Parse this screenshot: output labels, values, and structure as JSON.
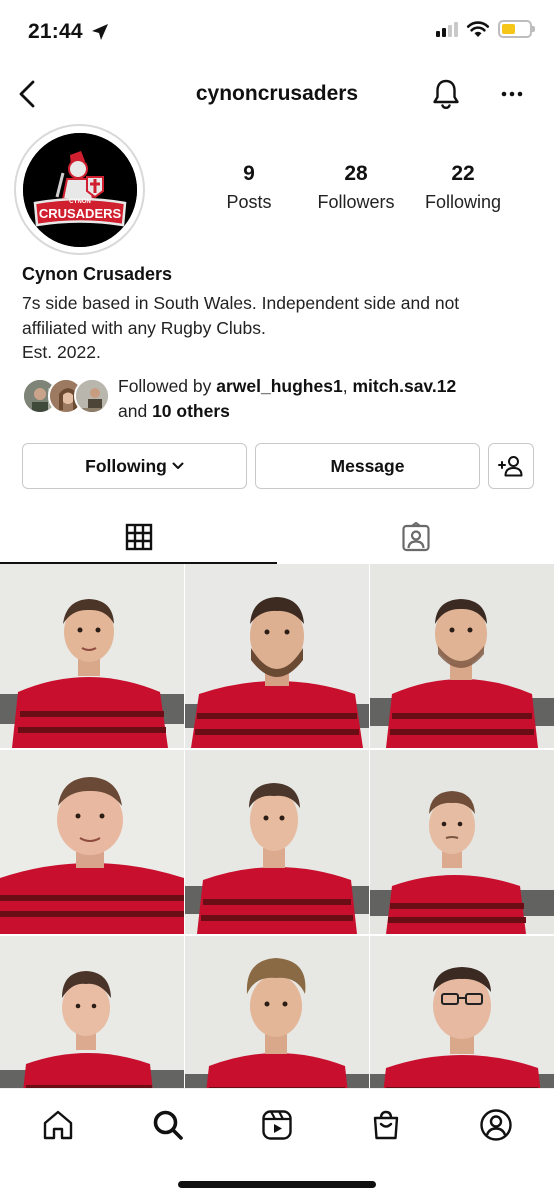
{
  "status_bar": {
    "time": "21:44"
  },
  "header": {
    "username": "cynoncrusaders"
  },
  "avatar": {
    "logo_top_text": "CYNON",
    "logo_main_text": "CRUSADERS"
  },
  "stats": [
    {
      "value": "9",
      "label": "Posts"
    },
    {
      "value": "28",
      "label": "Followers"
    },
    {
      "value": "22",
      "label": "Following"
    }
  ],
  "bio": {
    "name": "Cynon Crusaders",
    "line1": "7s side based in South Wales. Independent side and not",
    "line2": "affiliated with any Rugby Clubs.",
    "line3": "Est. 2022."
  },
  "followed_by": {
    "prefix": "Followed by ",
    "user1": "arwel_hughes1",
    "separator": ", ",
    "user2": "mitch.sav.12",
    "and_text": "and ",
    "others": "10 others"
  },
  "actions": {
    "following_label": "Following",
    "message_label": "Message"
  },
  "tabs": {
    "grid_icon": "grid-icon",
    "tagged_icon": "tagged-icon"
  },
  "posts": [
    {
      "caption_icon": "player-photo"
    },
    {
      "caption_icon": "player-photo"
    },
    {
      "caption_icon": "player-photo"
    },
    {
      "caption_icon": "player-photo"
    },
    {
      "caption_icon": "player-photo"
    },
    {
      "caption_icon": "player-photo"
    },
    {
      "caption_icon": "player-photo"
    },
    {
      "caption_icon": "player-photo"
    },
    {
      "caption_icon": "player-photo"
    }
  ],
  "bottom_nav": [
    "home-icon",
    "search-icon",
    "reels-icon",
    "shop-icon",
    "profile-icon"
  ],
  "colors": {
    "jersey_red": "#c8102e",
    "logo_red": "#d01f2f",
    "battery_yellow": "#f5c518"
  }
}
